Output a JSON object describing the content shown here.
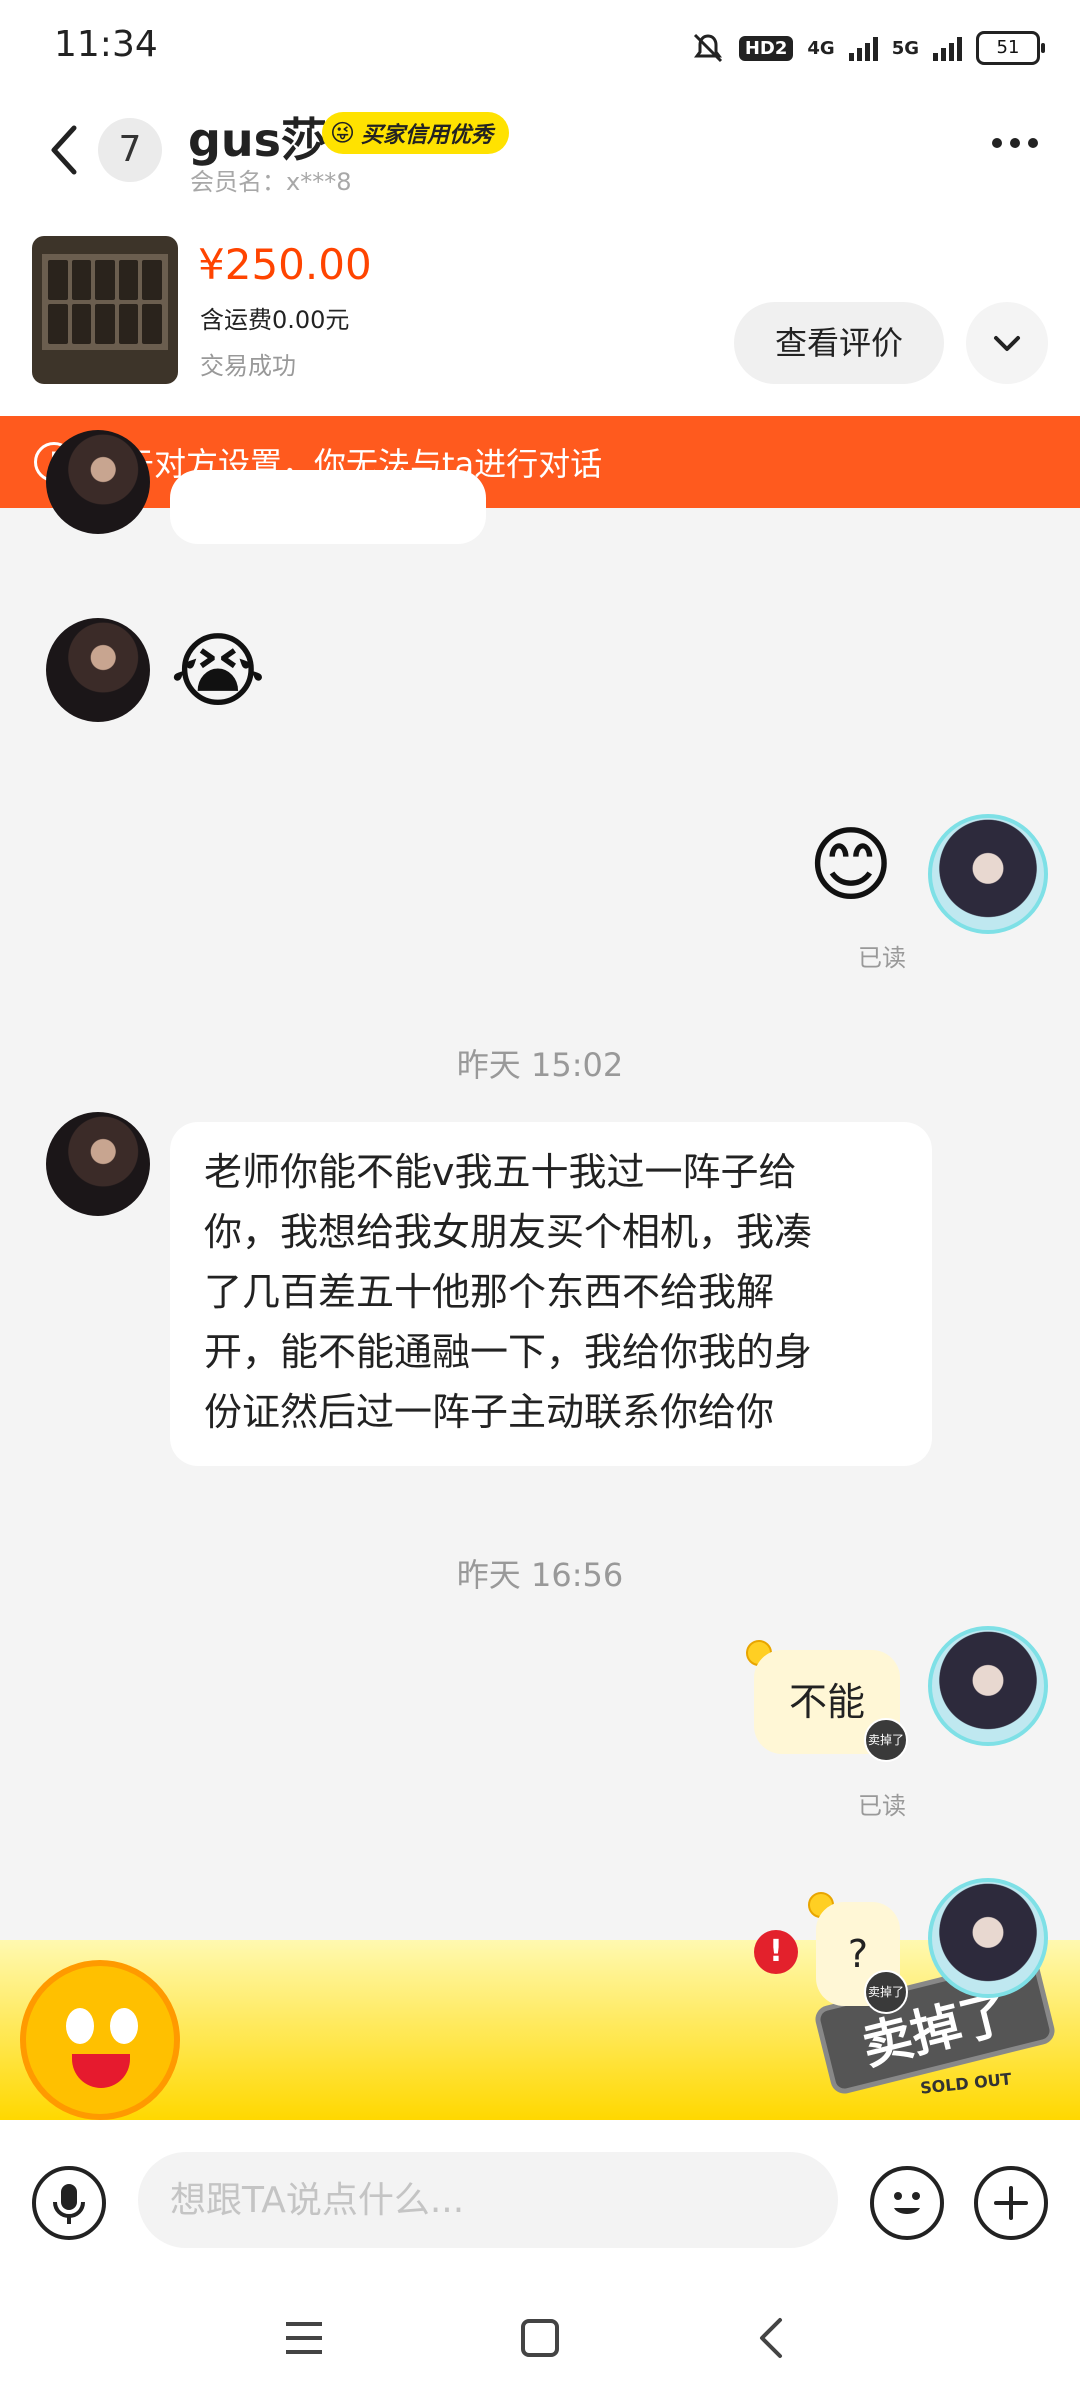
{
  "status_bar": {
    "time": "11:34",
    "hd_label": "HD2",
    "net_4g": "4G",
    "net_5g": "5G",
    "battery": "51"
  },
  "header": {
    "unread_count": "7",
    "username": "gus莎",
    "credit_badge": "买家信用优秀",
    "member_name": "会员名：x***8"
  },
  "product": {
    "price": "¥250.00",
    "shipping": "含运费0.00元",
    "status": "交易成功",
    "review_button": "查看评价"
  },
  "banner": {
    "text": "由于对方设置，你无法与ta进行对话"
  },
  "messages": {
    "emoji_left": "😭",
    "emoji_right": "😊",
    "read_label": "已读",
    "time_1": "昨天 15:02",
    "msg_left_line1": "老师你能不能v我五十我过一阵子给",
    "msg_left_line2": "你，我想给我女朋友买个相机，我凑",
    "msg_left_line3": "了几百差五十他那个东西不给我解",
    "msg_left_line4": "开，能不能通融一下，我给你我的身",
    "msg_left_line5": "份证然后过一阵子主动联系你给你",
    "time_2": "昨天 16:56",
    "msg_right_1": "不能",
    "read_label_2": "已读",
    "msg_right_2": "?",
    "fail_mark": "!",
    "sold_tag": "卖掉了"
  },
  "decoration": {
    "sold_out_text": "卖掉了",
    "sold_out_sub": "SOLD OUT"
  },
  "input": {
    "placeholder": "想跟TA说点什么..."
  },
  "colors": {
    "accent_orange": "#ff5a1e",
    "price_red": "#ff4400",
    "badge_yellow": "#ffe200",
    "bubble_right": "#fff7d6"
  }
}
